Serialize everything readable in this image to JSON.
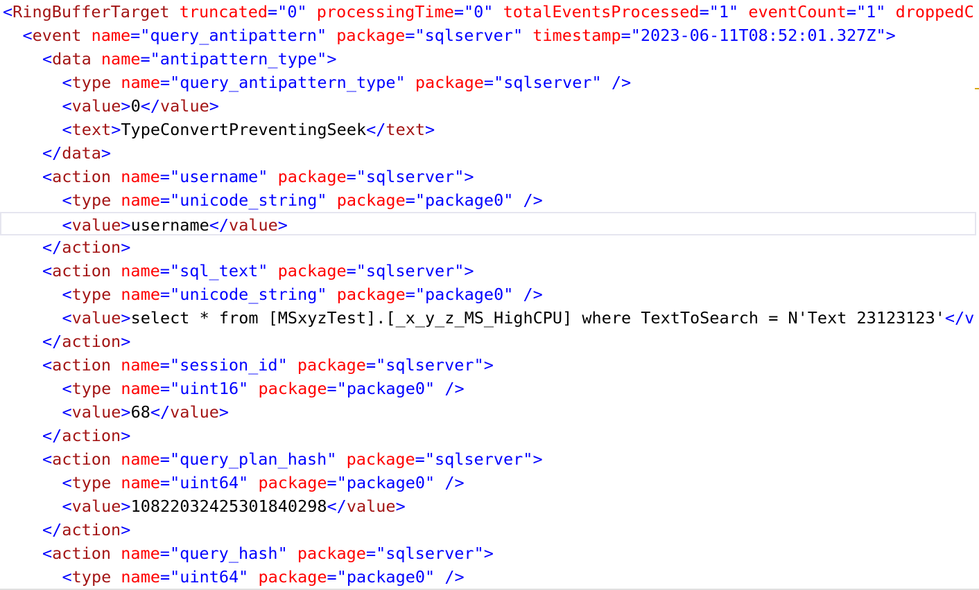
{
  "editor": {
    "colors": {
      "punctuation": "#0000ff",
      "element_name": "#a31515",
      "attribute_name": "#ff0000",
      "attribute_value": "#0000ff",
      "text": "#000000",
      "current_line_border": "#e5e5ef"
    },
    "lines": [
      {
        "indent": 0,
        "tokens": [
          [
            "b",
            "<"
          ],
          [
            "m",
            "RingBufferTarget"
          ],
          [
            "k",
            " "
          ],
          [
            "r",
            "truncated"
          ],
          [
            "b",
            "=\"0\""
          ],
          [
            "k",
            " "
          ],
          [
            "r",
            "processingTime"
          ],
          [
            "b",
            "=\"0\""
          ],
          [
            "k",
            " "
          ],
          [
            "r",
            "totalEventsProcessed"
          ],
          [
            "b",
            "=\"1\""
          ],
          [
            "k",
            " "
          ],
          [
            "r",
            "eventCount"
          ],
          [
            "b",
            "=\"1\""
          ],
          [
            "k",
            " "
          ],
          [
            "r",
            "droppedC"
          ]
        ]
      },
      {
        "indent": 1,
        "tokens": [
          [
            "b",
            "<"
          ],
          [
            "m",
            "event"
          ],
          [
            "k",
            " "
          ],
          [
            "r",
            "name"
          ],
          [
            "b",
            "=\"query_antipattern\""
          ],
          [
            "k",
            " "
          ],
          [
            "r",
            "package"
          ],
          [
            "b",
            "=\"sqlserver\""
          ],
          [
            "k",
            " "
          ],
          [
            "r",
            "timestamp"
          ],
          [
            "b",
            "=\"2023-06-11T08:52:01.327Z\">"
          ]
        ]
      },
      {
        "indent": 2,
        "tokens": [
          [
            "b",
            "<"
          ],
          [
            "m",
            "data"
          ],
          [
            "k",
            " "
          ],
          [
            "r",
            "name"
          ],
          [
            "b",
            "=\"antipattern_type\">"
          ]
        ]
      },
      {
        "indent": 3,
        "tokens": [
          [
            "b",
            "<"
          ],
          [
            "m",
            "type"
          ],
          [
            "k",
            " "
          ],
          [
            "r",
            "name"
          ],
          [
            "b",
            "=\"query_antipattern_type\""
          ],
          [
            "k",
            " "
          ],
          [
            "r",
            "package"
          ],
          [
            "b",
            "=\"sqlserver\""
          ],
          [
            "k",
            " "
          ],
          [
            "b",
            "/>"
          ]
        ]
      },
      {
        "indent": 3,
        "tokens": [
          [
            "b",
            "<"
          ],
          [
            "m",
            "value"
          ],
          [
            "b",
            ">"
          ],
          [
            "k",
            "0"
          ],
          [
            "b",
            "</"
          ],
          [
            "m",
            "value"
          ],
          [
            "b",
            ">"
          ]
        ]
      },
      {
        "indent": 3,
        "tokens": [
          [
            "b",
            "<"
          ],
          [
            "m",
            "text"
          ],
          [
            "b",
            ">"
          ],
          [
            "k",
            "TypeConvertPreventingSeek"
          ],
          [
            "b",
            "</"
          ],
          [
            "m",
            "text"
          ],
          [
            "b",
            ">"
          ]
        ]
      },
      {
        "indent": 2,
        "tokens": [
          [
            "b",
            "</"
          ],
          [
            "m",
            "data"
          ],
          [
            "b",
            ">"
          ]
        ]
      },
      {
        "indent": 2,
        "tokens": [
          [
            "b",
            "<"
          ],
          [
            "m",
            "action"
          ],
          [
            "k",
            " "
          ],
          [
            "r",
            "name"
          ],
          [
            "b",
            "=\"username\""
          ],
          [
            "k",
            " "
          ],
          [
            "r",
            "package"
          ],
          [
            "b",
            "=\"sqlserver\">"
          ]
        ]
      },
      {
        "indent": 3,
        "tokens": [
          [
            "b",
            "<"
          ],
          [
            "m",
            "type"
          ],
          [
            "k",
            " "
          ],
          [
            "r",
            "name"
          ],
          [
            "b",
            "=\"unicode_string\""
          ],
          [
            "k",
            " "
          ],
          [
            "r",
            "package"
          ],
          [
            "b",
            "=\"package0\""
          ],
          [
            "k",
            " "
          ],
          [
            "b",
            "/>"
          ]
        ]
      },
      {
        "indent": 3,
        "current": true,
        "tokens": [
          [
            "b",
            "<"
          ],
          [
            "m",
            "value"
          ],
          [
            "b",
            ">"
          ],
          [
            "k",
            "username"
          ],
          [
            "b",
            "</"
          ],
          [
            "m",
            "value"
          ],
          [
            "b",
            ">"
          ]
        ]
      },
      {
        "indent": 2,
        "tokens": [
          [
            "b",
            "</"
          ],
          [
            "m",
            "action"
          ],
          [
            "b",
            ">"
          ]
        ]
      },
      {
        "indent": 2,
        "tokens": [
          [
            "b",
            "<"
          ],
          [
            "m",
            "action"
          ],
          [
            "k",
            " "
          ],
          [
            "r",
            "name"
          ],
          [
            "b",
            "=\"sql_text\""
          ],
          [
            "k",
            " "
          ],
          [
            "r",
            "package"
          ],
          [
            "b",
            "=\"sqlserver\">"
          ]
        ]
      },
      {
        "indent": 3,
        "tokens": [
          [
            "b",
            "<"
          ],
          [
            "m",
            "type"
          ],
          [
            "k",
            " "
          ],
          [
            "r",
            "name"
          ],
          [
            "b",
            "=\"unicode_string\""
          ],
          [
            "k",
            " "
          ],
          [
            "r",
            "package"
          ],
          [
            "b",
            "=\"package0\""
          ],
          [
            "k",
            " "
          ],
          [
            "b",
            "/>"
          ]
        ]
      },
      {
        "indent": 3,
        "tokens": [
          [
            "b",
            "<"
          ],
          [
            "m",
            "value"
          ],
          [
            "b",
            ">"
          ],
          [
            "k",
            "select * from [MSxyzTest].[_x_y_z_MS_HighCPU] where TextToSearch = N'Text 23123123'"
          ],
          [
            "b",
            "</v"
          ]
        ]
      },
      {
        "indent": 2,
        "tokens": [
          [
            "b",
            "</"
          ],
          [
            "m",
            "action"
          ],
          [
            "b",
            ">"
          ]
        ]
      },
      {
        "indent": 2,
        "tokens": [
          [
            "b",
            "<"
          ],
          [
            "m",
            "action"
          ],
          [
            "k",
            " "
          ],
          [
            "r",
            "name"
          ],
          [
            "b",
            "=\"session_id\""
          ],
          [
            "k",
            " "
          ],
          [
            "r",
            "package"
          ],
          [
            "b",
            "=\"sqlserver\">"
          ]
        ]
      },
      {
        "indent": 3,
        "tokens": [
          [
            "b",
            "<"
          ],
          [
            "m",
            "type"
          ],
          [
            "k",
            " "
          ],
          [
            "r",
            "name"
          ],
          [
            "b",
            "=\"uint16\""
          ],
          [
            "k",
            " "
          ],
          [
            "r",
            "package"
          ],
          [
            "b",
            "=\"package0\""
          ],
          [
            "k",
            " "
          ],
          [
            "b",
            "/>"
          ]
        ]
      },
      {
        "indent": 3,
        "tokens": [
          [
            "b",
            "<"
          ],
          [
            "m",
            "value"
          ],
          [
            "b",
            ">"
          ],
          [
            "k",
            "68"
          ],
          [
            "b",
            "</"
          ],
          [
            "m",
            "value"
          ],
          [
            "b",
            ">"
          ]
        ]
      },
      {
        "indent": 2,
        "tokens": [
          [
            "b",
            "</"
          ],
          [
            "m",
            "action"
          ],
          [
            "b",
            ">"
          ]
        ]
      },
      {
        "indent": 2,
        "tokens": [
          [
            "b",
            "<"
          ],
          [
            "m",
            "action"
          ],
          [
            "k",
            " "
          ],
          [
            "r",
            "name"
          ],
          [
            "b",
            "=\"query_plan_hash\""
          ],
          [
            "k",
            " "
          ],
          [
            "r",
            "package"
          ],
          [
            "b",
            "=\"sqlserver\">"
          ]
        ]
      },
      {
        "indent": 3,
        "tokens": [
          [
            "b",
            "<"
          ],
          [
            "m",
            "type"
          ],
          [
            "k",
            " "
          ],
          [
            "r",
            "name"
          ],
          [
            "b",
            "=\"uint64\""
          ],
          [
            "k",
            " "
          ],
          [
            "r",
            "package"
          ],
          [
            "b",
            "=\"package0\""
          ],
          [
            "k",
            " "
          ],
          [
            "b",
            "/>"
          ]
        ]
      },
      {
        "indent": 3,
        "tokens": [
          [
            "b",
            "<"
          ],
          [
            "m",
            "value"
          ],
          [
            "b",
            ">"
          ],
          [
            "k",
            "10822032425301840298"
          ],
          [
            "b",
            "</"
          ],
          [
            "m",
            "value"
          ],
          [
            "b",
            ">"
          ]
        ]
      },
      {
        "indent": 2,
        "tokens": [
          [
            "b",
            "</"
          ],
          [
            "m",
            "action"
          ],
          [
            "b",
            ">"
          ]
        ]
      },
      {
        "indent": 2,
        "tokens": [
          [
            "b",
            "<"
          ],
          [
            "m",
            "action"
          ],
          [
            "k",
            " "
          ],
          [
            "r",
            "name"
          ],
          [
            "b",
            "=\"query_hash\""
          ],
          [
            "k",
            " "
          ],
          [
            "r",
            "package"
          ],
          [
            "b",
            "=\"sqlserver\">"
          ]
        ]
      },
      {
        "indent": 3,
        "tokens": [
          [
            "b",
            "<"
          ],
          [
            "m",
            "type"
          ],
          [
            "k",
            " "
          ],
          [
            "r",
            "name"
          ],
          [
            "b",
            "=\"uint64\""
          ],
          [
            "k",
            " "
          ],
          [
            "r",
            "package"
          ],
          [
            "b",
            "=\"package0\""
          ],
          [
            "k",
            " "
          ],
          [
            "b",
            "/>"
          ]
        ]
      }
    ]
  }
}
